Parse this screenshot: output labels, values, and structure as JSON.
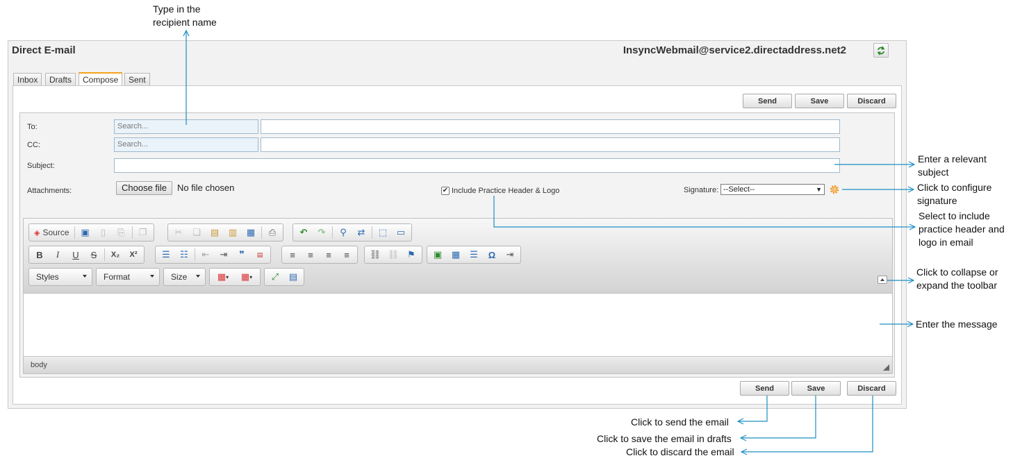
{
  "window": {
    "title": "Direct E-mail",
    "address": "InsyncWebmail@service2.directaddress.net2"
  },
  "tabs": [
    {
      "label": "Inbox"
    },
    {
      "label": "Drafts"
    },
    {
      "label": "Compose",
      "active": true
    },
    {
      "label": "Sent"
    }
  ],
  "actions": {
    "send": "Send",
    "save": "Save",
    "discard": "Discard"
  },
  "form": {
    "to_label": "To:",
    "cc_label": "CC:",
    "subject_label": "Subject:",
    "attachments_label": "Attachments:",
    "to_placeholder": "Search...",
    "cc_placeholder": "Search...",
    "choose_file": "Choose file",
    "no_file": "No file chosen",
    "include_header_label": "Include Practice Header & Logo",
    "include_header_checked": true,
    "signature_label": "Signature:",
    "signature_selected": "--Select--"
  },
  "editor": {
    "source_label": "Source",
    "styles": "Styles",
    "format": "Format",
    "size": "Size",
    "bold": "B",
    "italic": "I",
    "underline": "U",
    "strike": "S",
    "subscript": "X₂",
    "superscript": "X²",
    "quote": "❞",
    "omega": "Ω",
    "status_path": "body"
  },
  "annotations": {
    "recipient": "Type in the recipient name",
    "subject": "Enter a relevant subject",
    "signature": "Click to configure signature",
    "header": "Select to include practice header and logo in email",
    "toolbar": "Click to collapse or expand the toolbar",
    "message": "Enter the message",
    "send": "Click to send the email",
    "save": "Click to save the email in drafts",
    "discard": "Click to discard the email"
  },
  "colors": {
    "annotation_line": "#1b8ec2",
    "active_tab": "#f4a21b",
    "search_bg": "#eaf3fa",
    "gear": "#f29b2a"
  }
}
